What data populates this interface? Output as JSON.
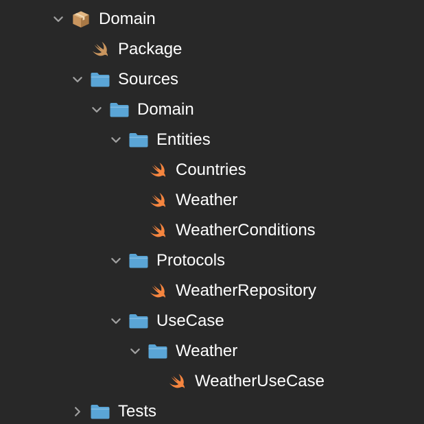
{
  "tree": {
    "root_label": "Domain",
    "package_label": "Package",
    "sources_label": "Sources",
    "domain_folder_label": "Domain",
    "entities_label": "Entities",
    "countries_label": "Countries",
    "weather_file_label": "Weather",
    "weather_conditions_label": "WeatherConditions",
    "protocols_label": "Protocols",
    "weather_repository_label": "WeatherRepository",
    "usecase_label": "UseCase",
    "weather_folder_label": "Weather",
    "weather_usecase_label": "WeatherUseCase",
    "tests_label": "Tests"
  },
  "icons": {
    "package_box": "package-icon",
    "manifest": "swift-icon",
    "folder": "folder-icon",
    "swift_file": "swift-icon",
    "expanded": "chevron-down-icon",
    "collapsed": "chevron-right-icon"
  },
  "colors": {
    "background": "#282828",
    "text": "#ffffff",
    "chevron": "#a0a0a0",
    "folder": "#5aa5d6",
    "swift": "#f5853f",
    "manifest_swift": "#c9955e",
    "package_box": "#c9955e"
  }
}
